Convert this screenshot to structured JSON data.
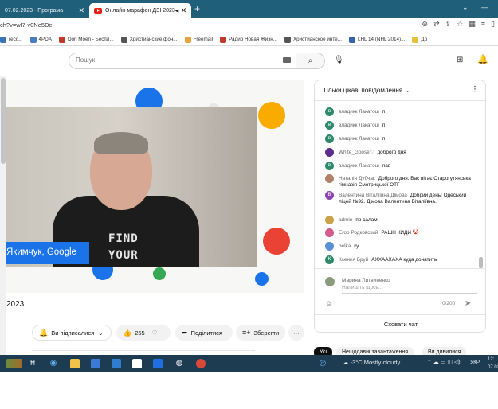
{
  "browser": {
    "tabs": [
      {
        "label": "07.02.2023 - Програма"
      },
      {
        "label": "Онлайн-марафон ДЗІ 2023"
      }
    ],
    "url": "ch?v=wI7-v0Ne5Dc",
    "bookmarks": [
      {
        "label": "reco...",
        "color": "#3b73b9"
      },
      {
        "label": "4PDA",
        "color": "#4a7cc4"
      },
      {
        "label": "Don Moen - Беспл...",
        "color": "#c0392b"
      },
      {
        "label": "Христианские фон...",
        "color": "#555555"
      },
      {
        "label": "Freemail",
        "color": "#e6a23c"
      },
      {
        "label": "Радио Новая Жизн...",
        "color": "#c0392b"
      },
      {
        "label": "Христианское инте...",
        "color": "#555555"
      },
      {
        "label": "LHL 14 (NHL 2014)...",
        "color": "#3b5fb0"
      },
      {
        "label": "До",
        "color": "#e6c13c"
      }
    ]
  },
  "youtube": {
    "search_placeholder": "Пошук"
  },
  "video": {
    "name_tag": "Якимчук, Google",
    "shirt_line1": "FIND",
    "shirt_line2": "YOUR",
    "title": "2023",
    "subscribed_label": "Ви підписалися",
    "like_count": "255",
    "share_label": "Поділитися",
    "save_label": "Зберегти"
  },
  "chat": {
    "mode_label": "Тільки цікаві повідомлення",
    "messages": [
      {
        "author": "владикк Лакатош",
        "text": "п",
        "initial": "в",
        "color": "#2e8b6a"
      },
      {
        "author": "владикк Лакатош",
        "text": "п",
        "initial": "в",
        "color": "#2e8b6a"
      },
      {
        "author": "владикк Лакатош",
        "text": "п",
        "initial": "в",
        "color": "#2e8b6a"
      },
      {
        "author": "White_Goose♡",
        "text": "доброго дня",
        "initial": "",
        "color": "#5b2d8c"
      },
      {
        "author": "владикк Лакатош",
        "text": "пав",
        "initial": "в",
        "color": "#2e8b6a"
      },
      {
        "author": "Наталія Дубчак",
        "text": "Доброго дня. Вас вітає Старогутянська гімназія Смотрицької ОТГ",
        "initial": "",
        "color": "#b0826a"
      },
      {
        "author": "Валентина Віталіївна Дімова",
        "text": "Добрий день! Одеський ліцей №92. Дімова Валентина Віталіївна.",
        "initial": "В",
        "color": "#8e44ad"
      },
      {
        "author": "admin",
        "text": "пр салам",
        "initial": "",
        "color": "#c9a24a"
      },
      {
        "author": "Егор Родковский",
        "text": "РАШН КИДИ 🤡",
        "initial": "",
        "color": "#d35c8c"
      },
      {
        "author": "belka",
        "text": "ку",
        "initial": "",
        "color": "#5b8fd6"
      },
      {
        "author": "Ксения Бруй",
        "text": "АХХААХАХА куда донатить",
        "initial": "К",
        "color": "#2e8b6a"
      }
    ],
    "current_user": "Марина Литвиненко",
    "input_placeholder": "Напишіть щось...",
    "char_counter": "0/200",
    "hide_chat_label": "Сховати чат"
  },
  "recommendations": {
    "chips": [
      "Усі",
      "Нещодавні завантаження",
      "Ви дивилися"
    ]
  },
  "taskbar": {
    "weather": "-3°C  Mostly cloudy",
    "language": "УКР",
    "time": "12:",
    "date": "07.02"
  }
}
